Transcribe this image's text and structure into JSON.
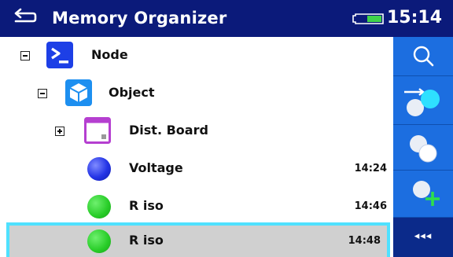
{
  "header": {
    "title": "Memory Organizer",
    "time": "15:14",
    "back_icon": "back-arrow-icon",
    "battery_icon": "battery-icon"
  },
  "tree": {
    "rows": [
      {
        "label": "Node",
        "icon": "terminal-node-icon",
        "toggle": "minus"
      },
      {
        "label": "Object",
        "icon": "cube-object-icon",
        "toggle": "minus"
      },
      {
        "label": "Dist. Board",
        "icon": "dist-board-icon",
        "toggle": "plus"
      },
      {
        "label": "Voltage",
        "icon": "blue-ball-icon",
        "time": "14:24"
      },
      {
        "label": "R iso",
        "icon": "green-ball-icon",
        "time": "14:46"
      },
      {
        "label": "R iso",
        "icon": "green-ball-icon",
        "time": "14:48",
        "selected": true
      }
    ]
  },
  "sidebar": {
    "buttons": [
      "search-icon",
      "start-test-icon",
      "clone-test-icon",
      "add-test-icon"
    ],
    "expand_label": "◂◂◂"
  },
  "colors": {
    "titlebar": "#0b1a7a",
    "sidebar": "#1c6ee0",
    "selection_border": "#4fe1ff",
    "selection_fill": "#d0d0d0"
  }
}
